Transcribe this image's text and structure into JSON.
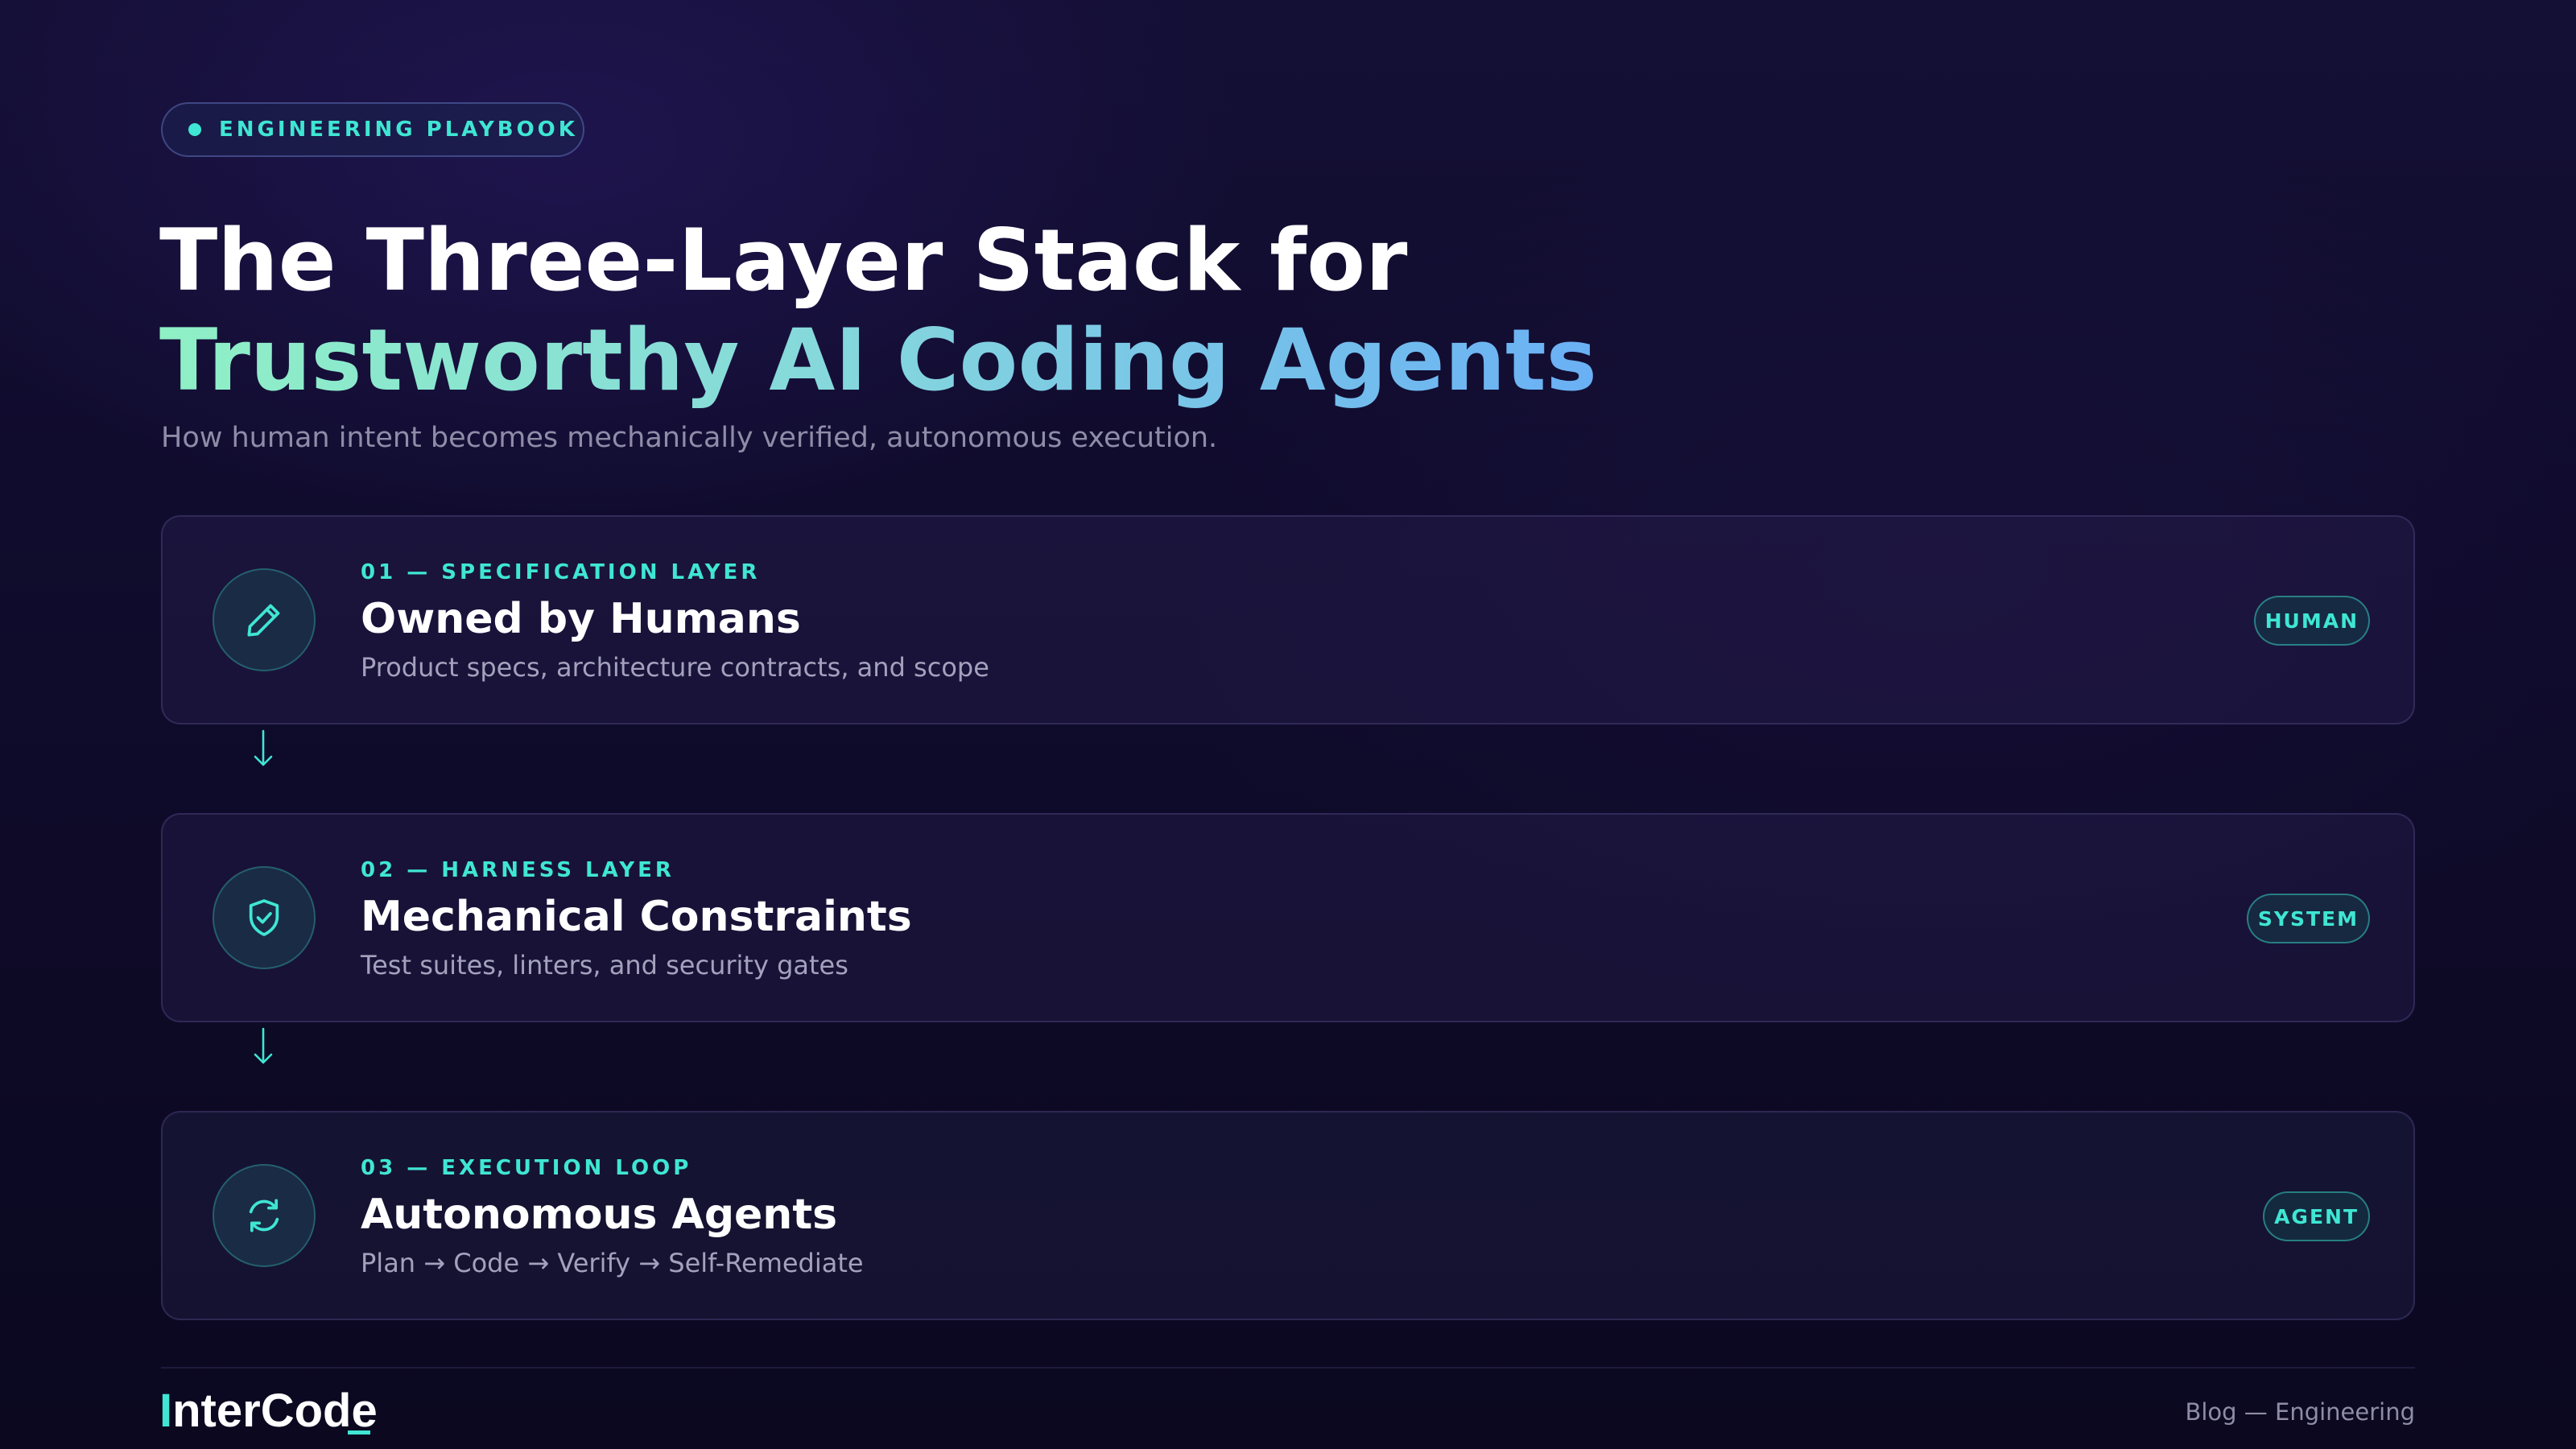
{
  "badge": {
    "label": "ENGINEERING PLAYBOOK"
  },
  "header": {
    "title_line_1": "The Three-Layer Stack for",
    "title_line_2": "Trustworthy AI Coding Agents",
    "subtitle": "How human intent becomes mechanically verified, autonomous execution."
  },
  "layers": [
    {
      "kicker": "01 — SPECIFICATION LAYER",
      "title": "Owned by Humans",
      "description": "Product specs, architecture contracts, and scope",
      "tag": "HUMAN",
      "icon": "pencil-icon"
    },
    {
      "kicker": "02 — HARNESS LAYER",
      "title": "Mechanical Constraints",
      "description": "Test suites, linters, and security gates",
      "tag": "SYSTEM",
      "icon": "shield-check-icon"
    },
    {
      "kicker": "03 — EXECUTION LOOP",
      "title": "Autonomous Agents",
      "description": "Plan → Code → Verify → Self-Remediate",
      "tag": "AGENT",
      "icon": "refresh-icon"
    }
  ],
  "footer": {
    "logo_initial": "I",
    "logo_rest": "nterCode",
    "meta": "Blog — Engineering"
  },
  "colors": {
    "accent": "#3fe6d3",
    "background": "#100c2d",
    "gradient_start": "#8ff0c6",
    "gradient_end": "#6ab0f5"
  }
}
